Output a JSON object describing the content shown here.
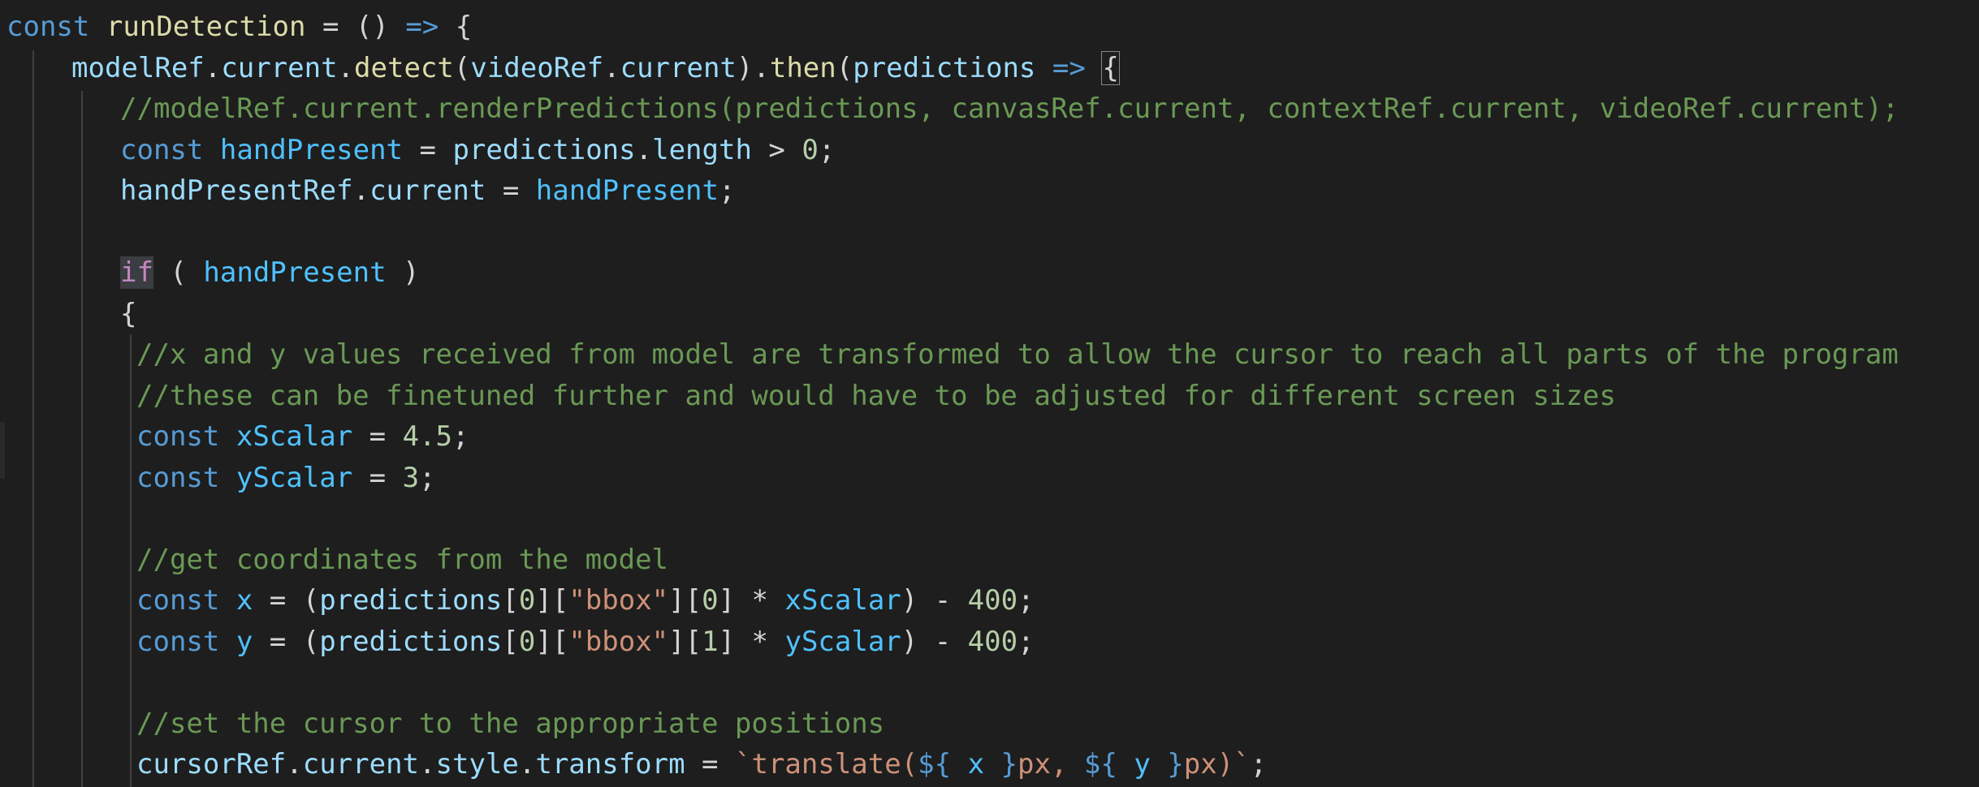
{
  "editor": {
    "theme": {
      "background": "#1e1e1e",
      "keyword": "#569cd6",
      "control_keyword": "#c586c0",
      "variable": "#9cdcfe",
      "constant": "#4fc1ff",
      "function": "#dcdcaa",
      "comment": "#6a9955",
      "string": "#ce9178",
      "number": "#b5cea8",
      "plain": "#d4d4d4"
    },
    "lines": [
      {
        "indent": 0,
        "tokens": [
          {
            "t": "const",
            "c": "k"
          },
          {
            "t": " ",
            "c": "pl"
          },
          {
            "t": "runDetection",
            "c": "f"
          },
          {
            "t": " = () ",
            "c": "p"
          },
          {
            "t": "=>",
            "c": "k"
          },
          {
            "t": " {",
            "c": "p"
          }
        ]
      },
      {
        "indent": 1,
        "tokens": [
          {
            "t": "modelRef",
            "c": "v"
          },
          {
            "t": ".",
            "c": "p"
          },
          {
            "t": "current",
            "c": "v"
          },
          {
            "t": ".",
            "c": "p"
          },
          {
            "t": "detect",
            "c": "f"
          },
          {
            "t": "(",
            "c": "p"
          },
          {
            "t": "videoRef",
            "c": "v"
          },
          {
            "t": ".",
            "c": "p"
          },
          {
            "t": "current",
            "c": "v"
          },
          {
            "t": ").",
            "c": "p"
          },
          {
            "t": "then",
            "c": "f"
          },
          {
            "t": "(",
            "c": "p"
          },
          {
            "t": "predictions",
            "c": "v"
          },
          {
            "t": " ",
            "c": "pl"
          },
          {
            "t": "=>",
            "c": "k"
          },
          {
            "t": " ",
            "c": "pl"
          },
          {
            "t": "{",
            "c": "bm"
          }
        ]
      },
      {
        "indent": 2,
        "tokens": [
          {
            "t": "//modelRef.current.renderPredictions(predictions, canvasRef.current, contextRef.current, videoRef.current);",
            "c": "cm"
          }
        ]
      },
      {
        "indent": 2,
        "tokens": [
          {
            "t": "const",
            "c": "k"
          },
          {
            "t": " ",
            "c": "pl"
          },
          {
            "t": "handPresent",
            "c": "c"
          },
          {
            "t": " = ",
            "c": "p"
          },
          {
            "t": "predictions",
            "c": "v"
          },
          {
            "t": ".",
            "c": "p"
          },
          {
            "t": "length",
            "c": "v"
          },
          {
            "t": " > ",
            "c": "p"
          },
          {
            "t": "0",
            "c": "n"
          },
          {
            "t": ";",
            "c": "p"
          }
        ]
      },
      {
        "indent": 2,
        "tokens": [
          {
            "t": "handPresentRef",
            "c": "v"
          },
          {
            "t": ".",
            "c": "p"
          },
          {
            "t": "current",
            "c": "v"
          },
          {
            "t": " = ",
            "c": "p"
          },
          {
            "t": "handPresent",
            "c": "c"
          },
          {
            "t": ";",
            "c": "p"
          }
        ]
      },
      {
        "indent": 2,
        "tokens": []
      },
      {
        "indent": 2,
        "tokens": [
          {
            "t": "if",
            "c": "ctl"
          },
          {
            "t": " ( ",
            "c": "p"
          },
          {
            "t": "handPresent",
            "c": "c"
          },
          {
            "t": " )",
            "c": "p"
          }
        ]
      },
      {
        "indent": 2,
        "tokens": [
          {
            "t": "{",
            "c": "p"
          }
        ]
      },
      {
        "indent": 3,
        "tokens": [
          {
            "t": "//x and y values received from model are transformed to allow the cursor to reach all parts of the program",
            "c": "cm"
          }
        ]
      },
      {
        "indent": 3,
        "tokens": [
          {
            "t": "//these can be finetuned further and would have to be adjusted for different screen sizes",
            "c": "cm"
          }
        ]
      },
      {
        "indent": 3,
        "tokens": [
          {
            "t": "const",
            "c": "k"
          },
          {
            "t": " ",
            "c": "pl"
          },
          {
            "t": "xScalar",
            "c": "c"
          },
          {
            "t": " = ",
            "c": "p"
          },
          {
            "t": "4.5",
            "c": "n"
          },
          {
            "t": ";",
            "c": "p"
          }
        ]
      },
      {
        "indent": 3,
        "tokens": [
          {
            "t": "const",
            "c": "k"
          },
          {
            "t": " ",
            "c": "pl"
          },
          {
            "t": "yScalar",
            "c": "c"
          },
          {
            "t": " = ",
            "c": "p"
          },
          {
            "t": "3",
            "c": "n"
          },
          {
            "t": ";",
            "c": "p"
          }
        ]
      },
      {
        "indent": 3,
        "tokens": []
      },
      {
        "indent": 3,
        "tokens": [
          {
            "t": "//get coordinates from the model",
            "c": "cm"
          }
        ]
      },
      {
        "indent": 3,
        "tokens": [
          {
            "t": "const",
            "c": "k"
          },
          {
            "t": " ",
            "c": "pl"
          },
          {
            "t": "x",
            "c": "c"
          },
          {
            "t": " = (",
            "c": "p"
          },
          {
            "t": "predictions",
            "c": "v"
          },
          {
            "t": "[",
            "c": "p"
          },
          {
            "t": "0",
            "c": "n"
          },
          {
            "t": "][",
            "c": "p"
          },
          {
            "t": "\"bbox\"",
            "c": "s"
          },
          {
            "t": "][",
            "c": "p"
          },
          {
            "t": "0",
            "c": "n"
          },
          {
            "t": "] * ",
            "c": "p"
          },
          {
            "t": "xScalar",
            "c": "c"
          },
          {
            "t": ") - ",
            "c": "p"
          },
          {
            "t": "400",
            "c": "n"
          },
          {
            "t": ";",
            "c": "p"
          }
        ]
      },
      {
        "indent": 3,
        "tokens": [
          {
            "t": "const",
            "c": "k"
          },
          {
            "t": " ",
            "c": "pl"
          },
          {
            "t": "y",
            "c": "c"
          },
          {
            "t": " = (",
            "c": "p"
          },
          {
            "t": "predictions",
            "c": "v"
          },
          {
            "t": "[",
            "c": "p"
          },
          {
            "t": "0",
            "c": "n"
          },
          {
            "t": "][",
            "c": "p"
          },
          {
            "t": "\"bbox\"",
            "c": "s"
          },
          {
            "t": "][",
            "c": "p"
          },
          {
            "t": "1",
            "c": "n"
          },
          {
            "t": "] * ",
            "c": "p"
          },
          {
            "t": "yScalar",
            "c": "c"
          },
          {
            "t": ") - ",
            "c": "p"
          },
          {
            "t": "400",
            "c": "n"
          },
          {
            "t": ";",
            "c": "p"
          }
        ]
      },
      {
        "indent": 3,
        "tokens": []
      },
      {
        "indent": 3,
        "tokens": [
          {
            "t": "//set the cursor to the appropriate positions",
            "c": "cm"
          }
        ]
      },
      {
        "indent": 3,
        "tokens": [
          {
            "t": "cursorRef",
            "c": "v"
          },
          {
            "t": ".",
            "c": "p"
          },
          {
            "t": "current",
            "c": "v"
          },
          {
            "t": ".",
            "c": "p"
          },
          {
            "t": "style",
            "c": "v"
          },
          {
            "t": ".",
            "c": "p"
          },
          {
            "t": "transform",
            "c": "v"
          },
          {
            "t": " = ",
            "c": "p"
          },
          {
            "t": "`translate(",
            "c": "s"
          },
          {
            "t": "${",
            "c": "k"
          },
          {
            "t": " x ",
            "c": "c"
          },
          {
            "t": "}",
            "c": "k"
          },
          {
            "t": "px, ",
            "c": "s"
          },
          {
            "t": "${",
            "c": "k"
          },
          {
            "t": " y ",
            "c": "c"
          },
          {
            "t": "}",
            "c": "k"
          },
          {
            "t": "px)`",
            "c": "s"
          },
          {
            "t": ";",
            "c": "p"
          }
        ]
      }
    ]
  }
}
